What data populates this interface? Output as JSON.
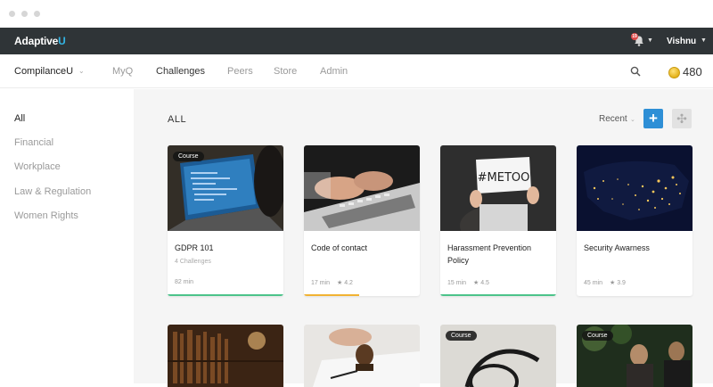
{
  "app": {
    "brand_prefix": "Adaptive",
    "brand_suffix": "U",
    "user_name": "Vishnu",
    "notification_count": "19"
  },
  "nav": {
    "org": "CompilanceU",
    "items": [
      "MyQ",
      "Challenges",
      "Peers",
      "Store",
      "Admin"
    ],
    "active": "Challenges",
    "points": "480"
  },
  "sidebar": {
    "items": [
      "All",
      "Financial",
      "Workplace",
      "Law & Regulation",
      "Women Rights"
    ],
    "active": "All"
  },
  "main": {
    "section_title": "ALL",
    "sort_label": "Recent",
    "add_label": "+",
    "move_label": "✣"
  },
  "cards": [
    {
      "title": "GDPR 101",
      "subtitle": "4 Challenges",
      "duration": "82 min",
      "rating": "",
      "badge": "Course",
      "bar_color": "#4cc38a"
    },
    {
      "title": "Code of contact",
      "subtitle": "",
      "duration": "17 min",
      "rating": "4.2",
      "badge": "",
      "bar_color": "#f1b233"
    },
    {
      "title": "Harassment Prevention Policy",
      "subtitle": "",
      "duration": "15 min",
      "rating": "4.5",
      "badge": "",
      "bar_color": "#4cc38a"
    },
    {
      "title": "Security Awarness",
      "subtitle": "",
      "duration": "45 min",
      "rating": "3.9",
      "badge": "",
      "bar_color": ""
    }
  ],
  "cards_row2": [
    {
      "badge": ""
    },
    {
      "badge": ""
    },
    {
      "badge": "Course"
    },
    {
      "badge": "Course"
    }
  ],
  "image_texts": {
    "metoo": "#METOO"
  },
  "colors": {
    "topbar": "#2f3437",
    "accent": "#2e8fd6",
    "brand_u": "#33b5e5"
  }
}
